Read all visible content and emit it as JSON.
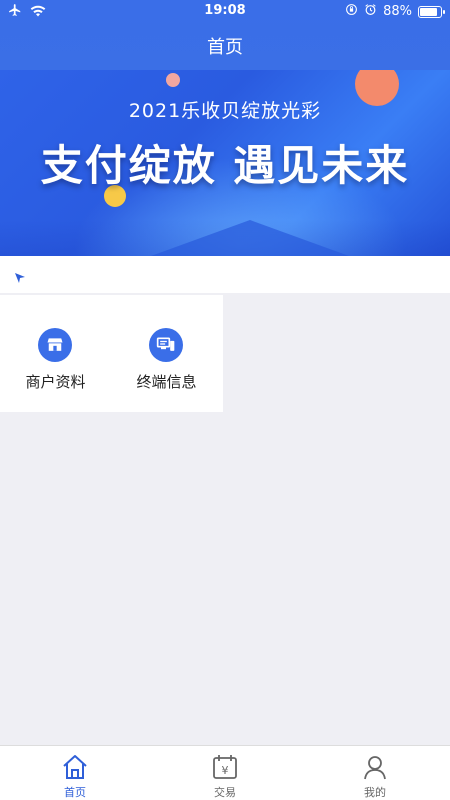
{
  "status_bar": {
    "time": "19:08",
    "battery_text": "88%",
    "battery_level": 0.88,
    "icons": [
      "airplane-icon",
      "wifi-icon",
      "rotation-lock-icon",
      "alarm-icon",
      "battery-icon"
    ]
  },
  "nav": {
    "title": "首页"
  },
  "banner": {
    "subtitle": "2021乐收贝绽放光彩",
    "headline": "支付绽放 遇见未来"
  },
  "menu": {
    "items": [
      {
        "label": "商户资料",
        "icon": "shop-icon"
      },
      {
        "label": "终端信息",
        "icon": "terminal-icon"
      }
    ]
  },
  "tabbar": {
    "items": [
      {
        "label": "首页",
        "icon": "home-icon",
        "active": true
      },
      {
        "label": "交易",
        "icon": "transaction-icon",
        "active": false
      },
      {
        "label": "我的",
        "icon": "profile-icon",
        "active": false
      }
    ]
  },
  "colors": {
    "primary": "#3a6ee8",
    "background": "#efeff4",
    "tab_active": "#2f5fd8",
    "tab_inactive": "#666666"
  }
}
